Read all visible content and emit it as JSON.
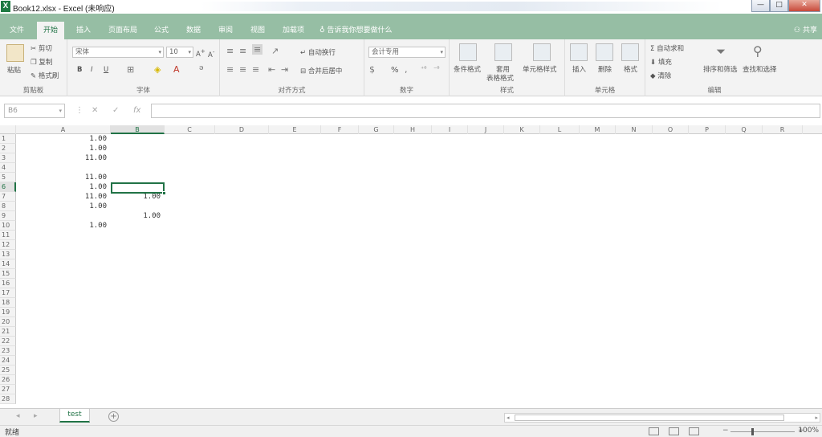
{
  "window": {
    "title": "Book12.xlsx - Excel (未响应)",
    "controls": [
      "—",
      "□",
      "✕"
    ]
  },
  "tabs": [
    {
      "label": "文件"
    },
    {
      "label": "开始"
    },
    {
      "label": "插入"
    },
    {
      "label": "页面布局"
    },
    {
      "label": "公式"
    },
    {
      "label": "数据"
    },
    {
      "label": "审阅"
    },
    {
      "label": "视图"
    },
    {
      "label": "加载项"
    }
  ],
  "active_tab": "开始",
  "tell_me": "告诉我你想要做什么",
  "share": "共享",
  "ribbon": {
    "clipboard": {
      "label": "剪贴板",
      "paste": "粘贴",
      "cut": "剪切",
      "copy": "复制",
      "format_painter": "格式刷"
    },
    "font": {
      "label": "字体",
      "font_name": "宋体",
      "font_size": "10",
      "bold": "B",
      "italic": "I",
      "underline": "U"
    },
    "alignment": {
      "label": "对齐方式",
      "wrap_text": "自动换行",
      "merge_center": "合并后居中"
    },
    "number": {
      "label": "数字",
      "format": "会计专用",
      "percent": "%"
    },
    "styles": {
      "label": "样式",
      "conditional": "条件格式",
      "format_table_1": "套用",
      "format_table_2": "表格格式",
      "cell_styles": "单元格样式"
    },
    "cells": {
      "label": "单元格",
      "insert": "插入",
      "delete": "删除",
      "format": "格式"
    },
    "editing": {
      "label": "编辑",
      "autosum": "自动求和",
      "fill": "填充",
      "clear": "清除",
      "sort_filter": "排序和筛选",
      "find_select": "查找和选择"
    }
  },
  "name_box": "B6",
  "fx": "fx",
  "columns": [
    "A",
    "B",
    "C",
    "D",
    "E",
    "F",
    "G",
    "H",
    "I",
    "J",
    "K",
    "L",
    "M",
    "N",
    "O",
    "P",
    "Q",
    "R"
  ],
  "rows": [
    "1",
    "2",
    "3",
    "4",
    "5",
    "6",
    "7",
    "8",
    "9",
    "10",
    "11",
    "12",
    "13",
    "14",
    "15",
    "16",
    "17",
    "18",
    "19",
    "20",
    "21",
    "22",
    "23",
    "24",
    "25",
    "26",
    "27",
    "28"
  ],
  "cells": [
    {
      "ref": "A1",
      "value": "1.00"
    },
    {
      "ref": "A2",
      "value": "1.00"
    },
    {
      "ref": "A3",
      "value": "11.00"
    },
    {
      "ref": "A5",
      "value": "11.00"
    },
    {
      "ref": "A6",
      "value": "1.00"
    },
    {
      "ref": "A7",
      "value": "11.00"
    },
    {
      "ref": "B7",
      "value": "1.00"
    },
    {
      "ref": "A8",
      "value": "1.00"
    },
    {
      "ref": "B9",
      "value": "1.00"
    },
    {
      "ref": "A10",
      "value": "1.00"
    }
  ],
  "selected_cell": "B6",
  "sheet_tab": "test",
  "add_sheet": "+",
  "status": {
    "ready": "就绪",
    "zoom_minus": "−",
    "zoom_plus": "+",
    "zoom": "100%"
  },
  "colors": {
    "accent": "#217346",
    "tabbar": "#96bea4"
  }
}
